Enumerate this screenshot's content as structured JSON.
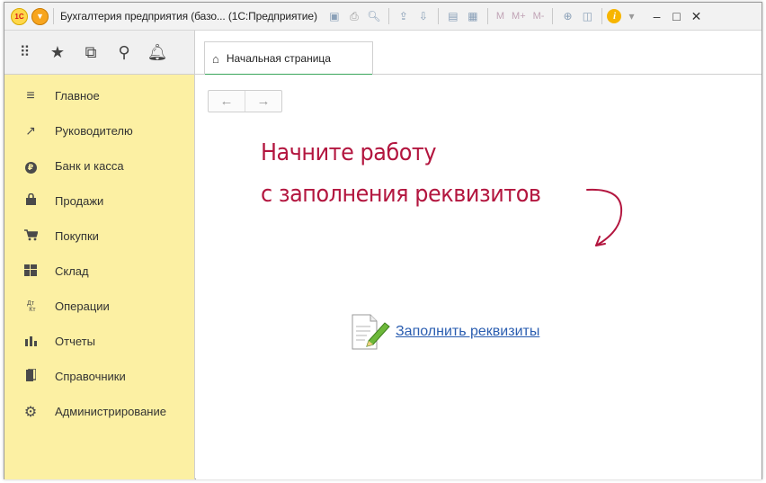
{
  "window": {
    "app_logo": "1С",
    "title": "Бухгалтерия предприятия (базо... (1С:Предприятие)",
    "toolbar_text_buttons": [
      "M",
      "M+",
      "M-"
    ],
    "controls": [
      "–",
      "□",
      "✕"
    ]
  },
  "iconbar": {
    "icons": [
      "grid-menu-icon",
      "star-icon",
      "history-icon",
      "search-icon",
      "bell-icon"
    ]
  },
  "tabs": [
    {
      "label": "Начальная страница",
      "icon": "home-icon"
    }
  ],
  "sidebar": {
    "items": [
      {
        "label": "Главное",
        "icon": "≡"
      },
      {
        "label": "Руководителю",
        "icon": "↗"
      },
      {
        "label": "Банк и касса",
        "icon": "₽"
      },
      {
        "label": "Продажи",
        "icon": "👜"
      },
      {
        "label": "Покупки",
        "icon": "🛒"
      },
      {
        "label": "Склад",
        "icon": "▦"
      },
      {
        "label": "Операции",
        "icon": "Дт/Кт"
      },
      {
        "label": "Отчеты",
        "icon": "📊"
      },
      {
        "label": "Справочники",
        "icon": "📋"
      },
      {
        "label": "Администрирование",
        "icon": "⚙"
      }
    ]
  },
  "content": {
    "hint_line1": "Начните работу",
    "hint_line2": "с заполнения реквизитов",
    "link_label": "Заполнить реквизиты"
  },
  "colors": {
    "sidebar_bg": "#fcf0a3",
    "hint_color": "#b3163f",
    "link_color": "#2a5db0",
    "tab_underline": "#3aa55b"
  }
}
